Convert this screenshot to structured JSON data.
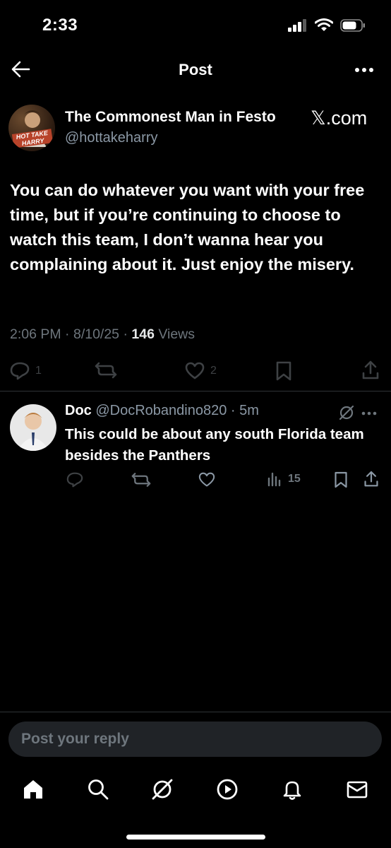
{
  "status_bar": {
    "time": "2:33"
  },
  "header": {
    "title": "Post"
  },
  "post": {
    "author_name": "The Commonest Man in Festo",
    "author_handle": "@hottakeharry",
    "avatar_text": "HOT TAKE HARRY",
    "source": "𝕏.com",
    "text": "You can do whatever you want with your free time, but if you’re continuing to choose to watch this team, I don’t wanna hear you complaining about it. Just enjoy the misery.",
    "time": "2:06 PM",
    "date": "8/10/25",
    "views_count": "146",
    "views_label": "Views",
    "reply_count": "1",
    "like_count": "2"
  },
  "reply": {
    "author_name": "Doc",
    "author_handle": "@DocRobandino820",
    "age": "5m",
    "text": "This could be about any south Florida team besides the Panthers",
    "views_count": "15"
  },
  "composer": {
    "placeholder": "Post your reply"
  },
  "colors": {
    "background": "#000000",
    "muted": "#6e767d",
    "divider": "#2f3336",
    "input_bg": "#202327"
  }
}
